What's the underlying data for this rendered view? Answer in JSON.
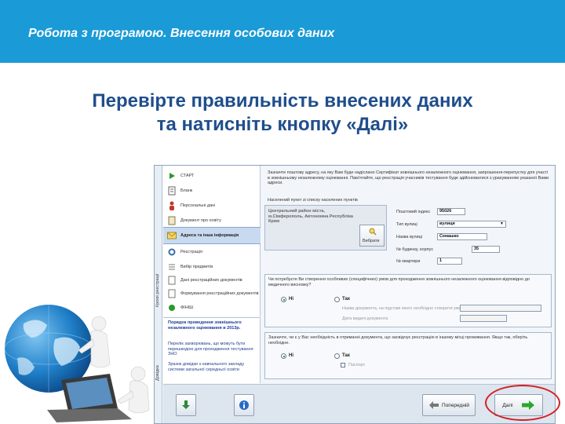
{
  "slide": {
    "title": "Робота з програмою. Внесення особових даних",
    "instruction_line1": "Перевірте правильність внесених даних",
    "instruction_line2": "та натисніть кнопку «Далі»"
  },
  "app": {
    "vertical_labels": [
      "Кроки реєстрації",
      "Довідка"
    ],
    "nav": [
      {
        "label": "СТАРТ",
        "icon": "play-icon"
      },
      {
        "label": "Бланк",
        "icon": "form-icon"
      },
      {
        "label": "Персональні дані",
        "icon": "person-icon"
      },
      {
        "label": "Документ про освіту",
        "icon": "document-icon"
      },
      {
        "label": "Адреса та інша інформація",
        "icon": "envelope-icon",
        "active": true
      },
      {
        "label": "Реєстрація",
        "icon": "gear-icon"
      },
      {
        "label": "Вибір предметів",
        "icon": "list-icon"
      },
      {
        "label": "Дані реєстраційних документів",
        "icon": "page-icon"
      },
      {
        "label": "Формування реєстраційних документів",
        "icon": "page-icon"
      },
      {
        "label": "ФІНІШ",
        "icon": "finish-icon"
      }
    ],
    "info_links": [
      {
        "text": "Порядок проведення зовнішнього незалежного оцінювання в 2013р.",
        "bold": true
      },
      {
        "text": "Перелік захворювань, що можуть бути перешкодою для проходження тестування ЗНО",
        "bold": false
      },
      {
        "text": "Зразок довідки з навчального закладу системи загальної середньої освіти",
        "bold": false
      }
    ],
    "address": {
      "intro": "Зазначте поштову адресу, на яку Вам буде надіслано Сертифікат зовнішнього незалежного оцінювання, запрошення-перепустку для участі в зовнішньому незалежному оцінюванні. Пам'ятайте, що реєстрація учасників тестування буде здійснюватися з урахуванням указаної Вами адреси.",
      "select_label": "Населений пункт зі списку населених пунктів",
      "settlement": "Центральний район міста, м.Сімферополь, Автономна Республіка Крим",
      "choose_button": "Вибрати",
      "postal_code_label": "Поштовий індекс",
      "postal_code": "95026",
      "street_type_label": "Тип вулиці",
      "street_type": "вулиця",
      "street_name_label": "Назва вулиці",
      "street_name": "Семашко",
      "house_label": "№ будинку, корпус",
      "house": "35",
      "apartment_label": "№ квартири",
      "apartment": "1"
    },
    "special_conditions": {
      "question": "Чи потребуєте Ви створення особливих (специфічних) умов для проходження зовнішнього незалежного оцінювання відповідно до медичного висновку?",
      "no_label": "Ні",
      "yes_label": "Так",
      "doc_name_label": "Назва документа, на підставі якого необхідно створити умови",
      "doc_date_label": "Дата видачі документа"
    },
    "residence_question": {
      "question": "Зазначте, чи є у Вас необхідність в отриманні документа, що засвідчує реєстрацію в іншому місці проживання. Якщо так, оберіть необхідне.",
      "no_label": "Ні",
      "yes_label": "Так",
      "checkbox_label": "Паспорт"
    },
    "toolbar": {
      "back_label": "Попередній",
      "next_label": "Далі"
    }
  }
}
